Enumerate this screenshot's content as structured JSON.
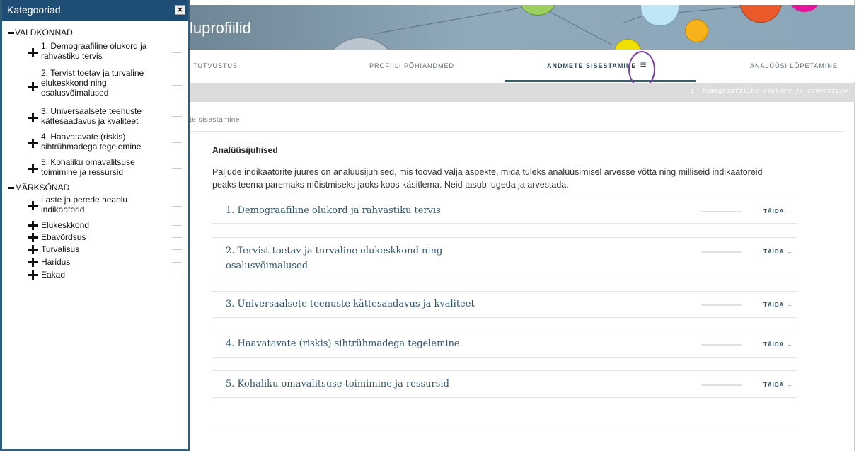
{
  "window": {
    "title": "luprofiilid"
  },
  "tabs": [
    {
      "label": "TUTVUSTUS"
    },
    {
      "label": "PROFIILI PÕHIANDMED"
    },
    {
      "label": "ANDMETE SISESTAMINE"
    },
    {
      "label": "ANALÜÜSI LÕPETAMINE"
    }
  ],
  "subbar": {
    "text": "1. Demograafiline olukord ja rahvastiku"
  },
  "breadcrumb": "te sisestamine",
  "main": {
    "section_title": "Analüüsijuhised",
    "intro": "Paljude indikaatorite juures on analüüsijuhised, mis toovad välja aspekte, mida tuleks analüüsimisel arvesse võtta ning milliseid indikaatoreid peaks teema paremaks mõistmiseks jaoks koos käsitlema. Neid tasub lugeda ja arvestada.",
    "items": [
      {
        "title": "1. Demograafiline olukord ja rahvastiku tervis",
        "action": "TÄIDA →"
      },
      {
        "title": "2. Tervist toetav ja turvaline elukeskkond ning osalusvõimalused",
        "action": "TÄIDA →"
      },
      {
        "title": "3. Universaalsete teenuste kättesaadavus ja kvaliteet",
        "action": "TÄIDA →"
      },
      {
        "title": "4. Haavatavate (riskis) sihtrühmadega tegelemine",
        "action": "TÄIDA →"
      },
      {
        "title": "5. Kohaliku omavalitsuse toimimine ja ressursid",
        "action": "TÄIDA →"
      }
    ]
  },
  "panel": {
    "title": "Kategooriad",
    "close": "×",
    "groups": [
      {
        "label": "VALDKONNAD"
      },
      {
        "label": "MÄRKSÕNAD"
      }
    ],
    "valdkonnad": [
      {
        "label": "1. Demograafiline olukord ja rahvastiku tervis"
      },
      {
        "label": "2. Tervist toetav ja turvaline elukeskkond ning osalusvõimalused"
      },
      {
        "label": "3. Universaalsete teenuste kättesaadavus ja kvaliteet"
      },
      {
        "label": "4. Haavatavate (riskis) sihtrühmadega tegelemine"
      },
      {
        "label": "5. Kohaliku omavalitsuse toimimine ja ressursid"
      }
    ],
    "marksonad": [
      {
        "label": "Laste ja perede heaolu indikaatorid"
      },
      {
        "label": "Elukeskkond"
      },
      {
        "label": "Ebavõrdsus"
      },
      {
        "label": "Turvalisus"
      },
      {
        "label": "Haridus"
      },
      {
        "label": "Eakad"
      }
    ]
  },
  "colors": {
    "panel_header": "#1e4e73",
    "accent": "#2d5468",
    "highlight": "#7a3fa0"
  },
  "icons": {
    "menu": "hamburger-icon",
    "expand": "plus-icon",
    "collapse": "minus-icon",
    "close": "close-icon"
  }
}
